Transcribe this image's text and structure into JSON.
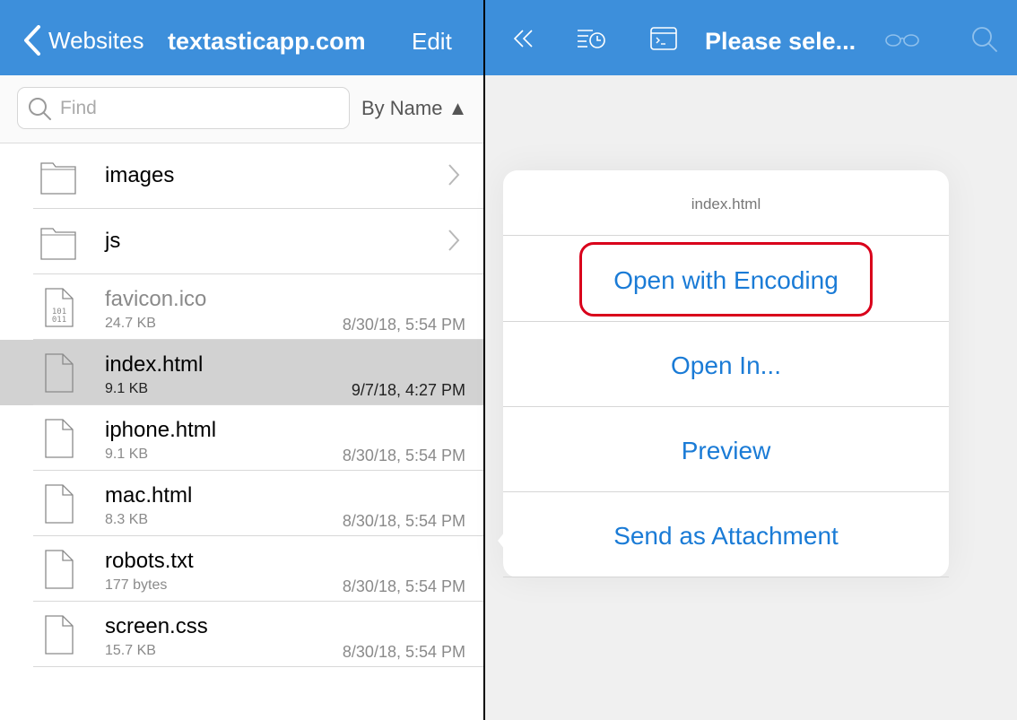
{
  "left_nav": {
    "back_label": "Websites",
    "title": "textasticapp.com",
    "edit_label": "Edit",
    "color": "#3d8fdb"
  },
  "search": {
    "placeholder": "Find",
    "value": "",
    "sort_label": "By Name ▲"
  },
  "files": [
    {
      "name": "images",
      "type": "folder",
      "icon": "folder-icon"
    },
    {
      "name": "js",
      "type": "folder",
      "icon": "folder-icon"
    },
    {
      "name": "favicon.ico",
      "type": "binary",
      "size": "24.7 KB",
      "date": "8/30/18, 5:54 PM",
      "icon": "binary-file-icon"
    },
    {
      "name": "index.html",
      "type": "file",
      "size": "9.1 KB",
      "date": "9/7/18, 4:27 PM",
      "icon": "file-icon",
      "selected": true
    },
    {
      "name": "iphone.html",
      "type": "file",
      "size": "9.1 KB",
      "date": "8/30/18, 5:54 PM",
      "icon": "file-icon"
    },
    {
      "name": "mac.html",
      "type": "file",
      "size": "8.3 KB",
      "date": "8/30/18, 5:54 PM",
      "icon": "file-icon"
    },
    {
      "name": "robots.txt",
      "type": "file",
      "size": "177 bytes",
      "date": "8/30/18, 5:54 PM",
      "icon": "file-icon"
    },
    {
      "name": "screen.css",
      "type": "file",
      "size": "15.7 KB",
      "date": "8/30/18, 5:54 PM",
      "icon": "file-icon"
    }
  ],
  "right_nav": {
    "title": "Please sele...",
    "icons": [
      "collapse-sidebar-icon",
      "recent-files-icon",
      "terminal-icon",
      "reading-glasses-icon",
      "search-icon"
    ]
  },
  "popover": {
    "title": "index.html",
    "items": [
      "Open with Encoding",
      "Open In...",
      "Preview",
      "Send as Attachment"
    ],
    "highlight_color": "#d9001b"
  }
}
